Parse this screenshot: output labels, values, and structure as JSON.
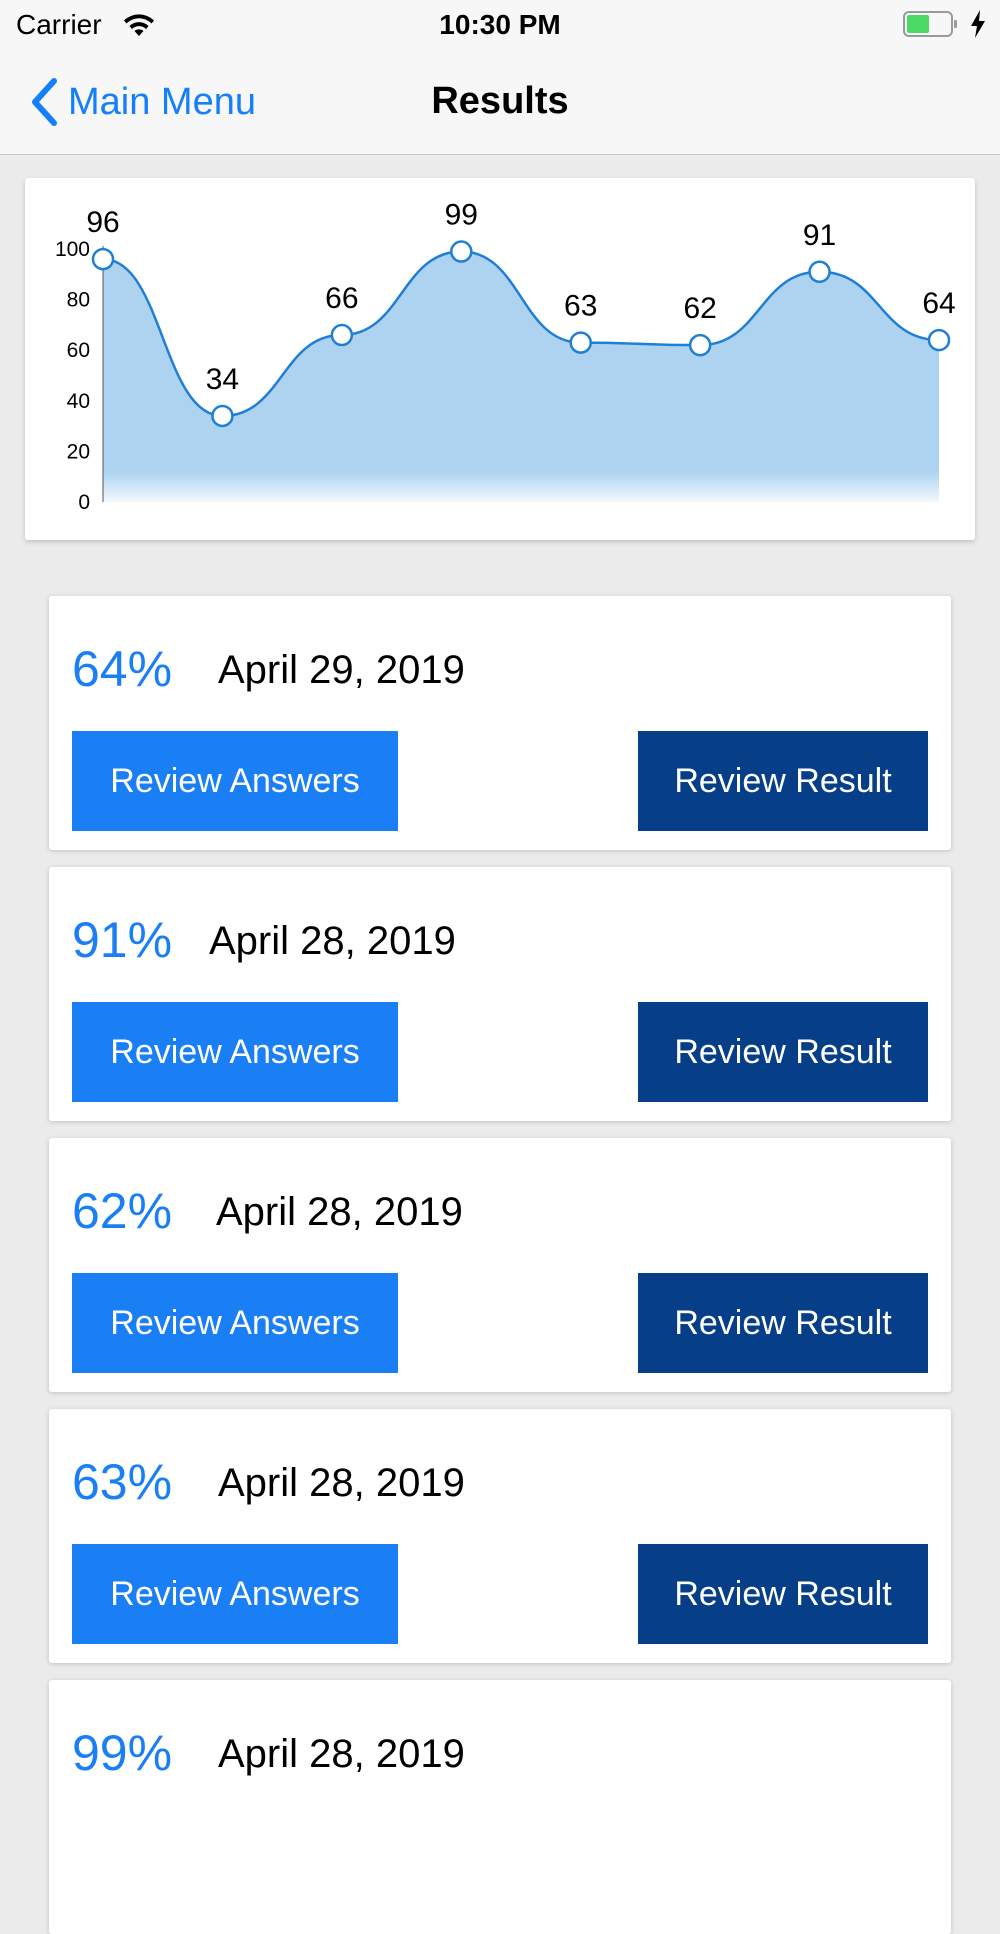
{
  "status_bar": {
    "carrier": "Carrier",
    "time": "10:30 PM",
    "icons": [
      "wifi-icon",
      "battery-icon",
      "charging-bolt-icon"
    ],
    "battery_color": "#4cd964"
  },
  "nav": {
    "back_label": "Main Menu",
    "back_icon": "chevron-left-icon",
    "title": "Results"
  },
  "colors": {
    "accent": "#1a7ff4",
    "dark_button": "#063f88",
    "area_fill": "#add3f1",
    "line": "#1f7fd4"
  },
  "chart_data": {
    "type": "area",
    "x": [
      1,
      2,
      3,
      4,
      5,
      6,
      7,
      8
    ],
    "values": [
      96,
      34,
      66,
      99,
      63,
      62,
      91,
      64
    ],
    "ylim": [
      0,
      100
    ],
    "y_ticks": [
      "0",
      "20",
      "40",
      "60",
      "80",
      "100"
    ],
    "data_labels": [
      "96",
      "34",
      "66",
      "99",
      "63",
      "62",
      "91",
      "64"
    ],
    "smooth": true,
    "grid": false,
    "legend": "none",
    "title": "",
    "xlabel": "",
    "ylabel": ""
  },
  "results": [
    {
      "score": "64%",
      "date": "April 29, 2019",
      "review_answers": "Review Answers",
      "review_result": "Review Result"
    },
    {
      "score": "91%",
      "date": "April 28, 2019",
      "review_answers": "Review Answers",
      "review_result": "Review Result"
    },
    {
      "score": "62%",
      "date": "April 28, 2019",
      "review_answers": "Review Answers",
      "review_result": "Review Result"
    },
    {
      "score": "63%",
      "date": "April 28, 2019",
      "review_answers": "Review Answers",
      "review_result": "Review Result"
    },
    {
      "score": "99%",
      "date": "April 28, 2019"
    }
  ]
}
